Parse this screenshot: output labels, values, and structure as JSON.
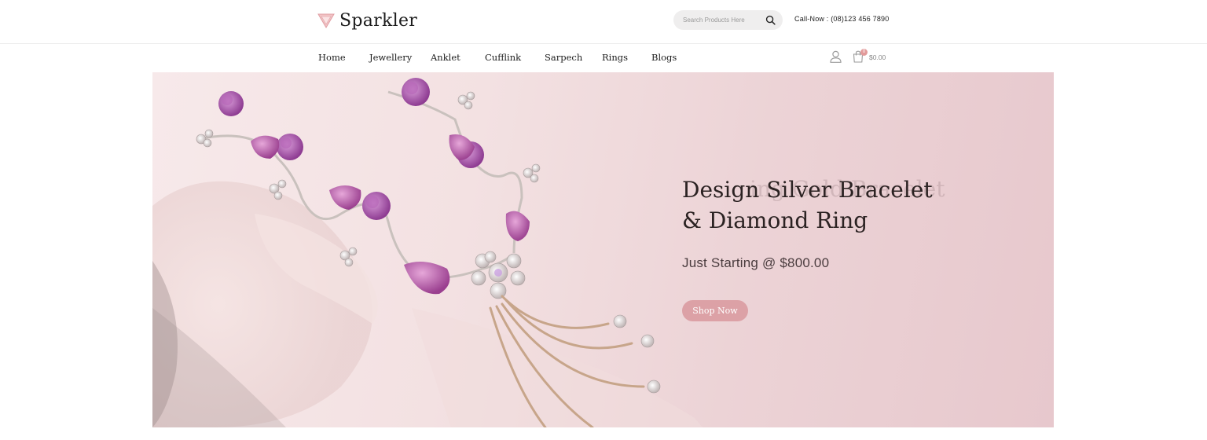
{
  "brand": {
    "name": "Sparkler",
    "accent": "#e6a3a8"
  },
  "search": {
    "placeholder": "Search Products Here",
    "icon": "search-icon"
  },
  "contact": {
    "call_now": "Call-Now : (08)123 456 7890"
  },
  "nav": {
    "items": [
      {
        "label": "Home"
      },
      {
        "label": "Jewellery"
      },
      {
        "label": "Anklet"
      },
      {
        "label": "Cufflink"
      },
      {
        "label": "Sarpech"
      },
      {
        "label": "Rings"
      },
      {
        "label": "Blogs"
      }
    ]
  },
  "cart": {
    "count": "0",
    "total": "$0.00",
    "icon": "cart-icon"
  },
  "account": {
    "icon": "user-icon"
  },
  "hero": {
    "ghost_title": "ing Gold Bracelet",
    "title_line1": "Design Silver Bracelet",
    "title_line2": "& Diamond Ring",
    "subtitle": "Just Starting @ $800.00",
    "button_label": "Shop Now",
    "button_color": "#dca1a6"
  }
}
